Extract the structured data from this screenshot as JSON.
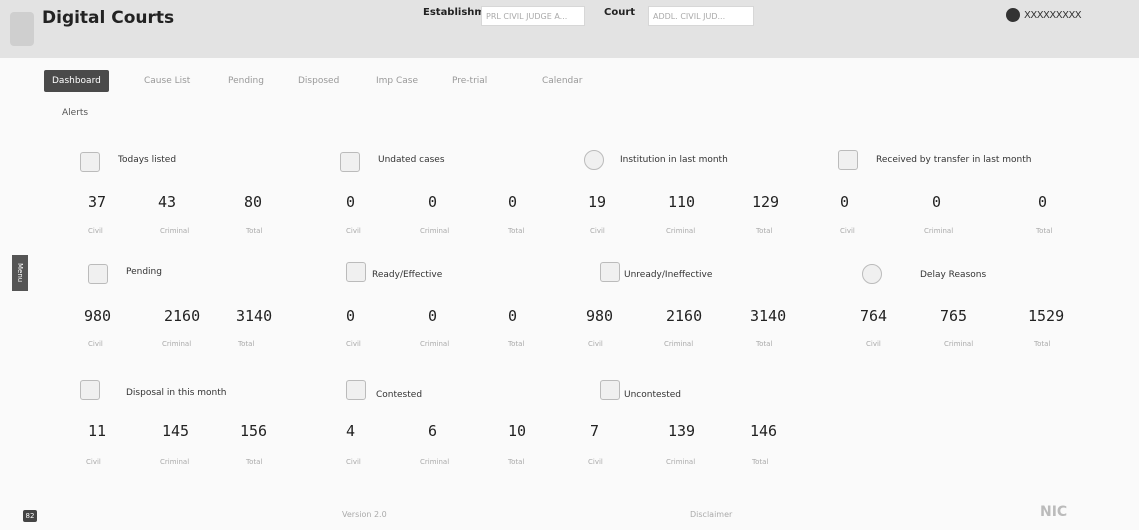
{
  "header": {
    "title": "Digital Courts",
    "establishment_label": "Establishment",
    "establishment_value": "PRL CIVIL JUDGE A...",
    "court_label": "Court",
    "court_value": "ADDL. CIVIL JUD...",
    "user_name": "XXXXXXXXX"
  },
  "tabs": [
    {
      "label": "Dashboard"
    },
    {
      "label": "Cause List"
    },
    {
      "label": "Pending"
    },
    {
      "label": "Disposed"
    },
    {
      "label": "Imp Case"
    },
    {
      "label": "Pre-trial"
    },
    {
      "label": "Calendar"
    }
  ],
  "alerts_label": "Alerts",
  "cards": [
    {
      "title": "Todays listed",
      "civil": "37",
      "criminal": "43",
      "total": "80"
    },
    {
      "title": "Undated cases",
      "civil": "0",
      "criminal": "0",
      "total": "0"
    },
    {
      "title": "Institution in last month",
      "civil": "19",
      "criminal": "110",
      "total": "129"
    },
    {
      "title": "Received by transfer in last month",
      "civil": "0",
      "criminal": "0",
      "total": "0"
    },
    {
      "title": "Pending",
      "civil": "980",
      "criminal": "2160",
      "total": "3140"
    },
    {
      "title": "Ready/Effective",
      "civil": "0",
      "criminal": "0",
      "total": "0"
    },
    {
      "title": "Unready/Ineffective",
      "civil": "980",
      "criminal": "2160",
      "total": "3140"
    },
    {
      "title": "Delay Reasons",
      "civil": "764",
      "criminal": "765",
      "total": "1529"
    },
    {
      "title": "Disposal in this month",
      "civil": "11",
      "criminal": "145",
      "total": "156"
    },
    {
      "title": "Contested",
      "civil": "4",
      "criminal": "6",
      "total": "10"
    },
    {
      "title": "Uncontested",
      "civil": "7",
      "criminal": "139",
      "total": "146"
    }
  ],
  "labels": {
    "civil": "Civil",
    "criminal": "Criminal",
    "total": "Total"
  },
  "menu_label": "Menu",
  "footer": {
    "badge": "82",
    "version": "Version 2.0",
    "disclaimer": "Disclaimer",
    "nic": "NIC"
  }
}
